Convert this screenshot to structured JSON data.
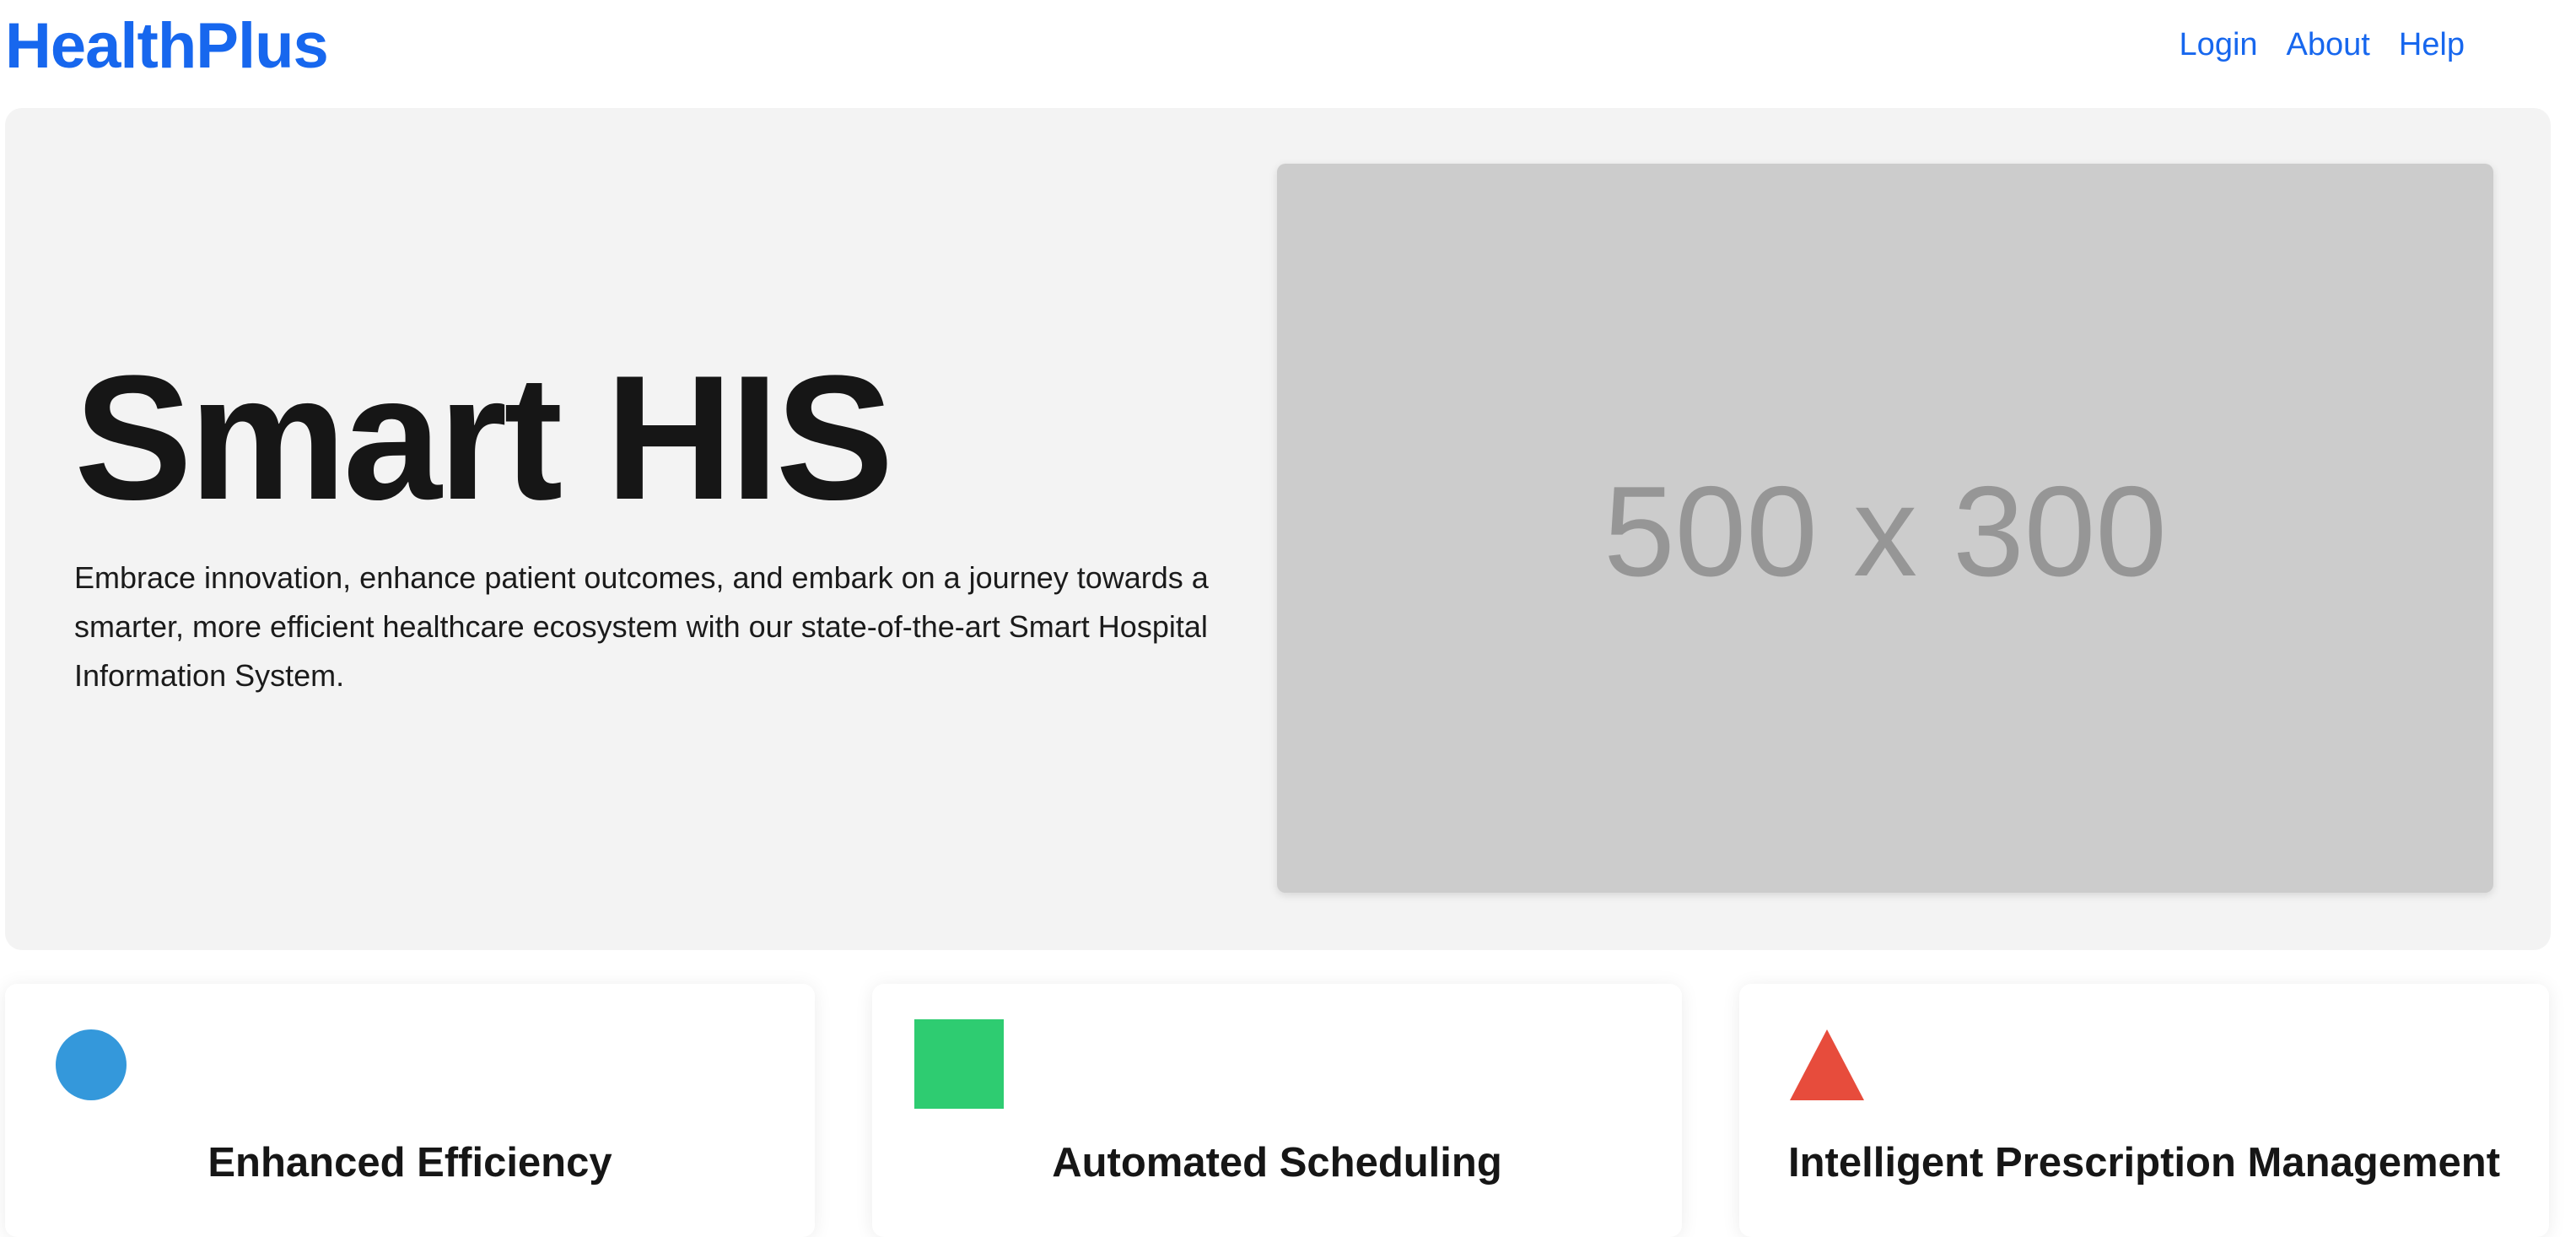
{
  "header": {
    "brand": "HealthPlus",
    "nav": {
      "login": "Login",
      "about": "About",
      "help": "Help"
    }
  },
  "hero": {
    "title": "Smart HIS",
    "description": "Embrace innovation, enhance patient outcomes, and embark on a journey towards a smarter, more efficient healthcare ecosystem with our state-of-the-art Smart Hospital Information System.",
    "image_placeholder": "500 x 300"
  },
  "features": [
    {
      "title": "Enhanced Efficiency",
      "icon": "circle-icon",
      "color": "#3498db"
    },
    {
      "title": "Automated Scheduling",
      "icon": "square-icon",
      "color": "#2ecc71"
    },
    {
      "title": "Intelligent Prescription Management",
      "icon": "triangle-icon",
      "color": "#e74c3c"
    }
  ],
  "colors": {
    "brand": "#1767ee",
    "hero_background": "#f3f3f3",
    "image_placeholder_background": "#cccccc"
  }
}
